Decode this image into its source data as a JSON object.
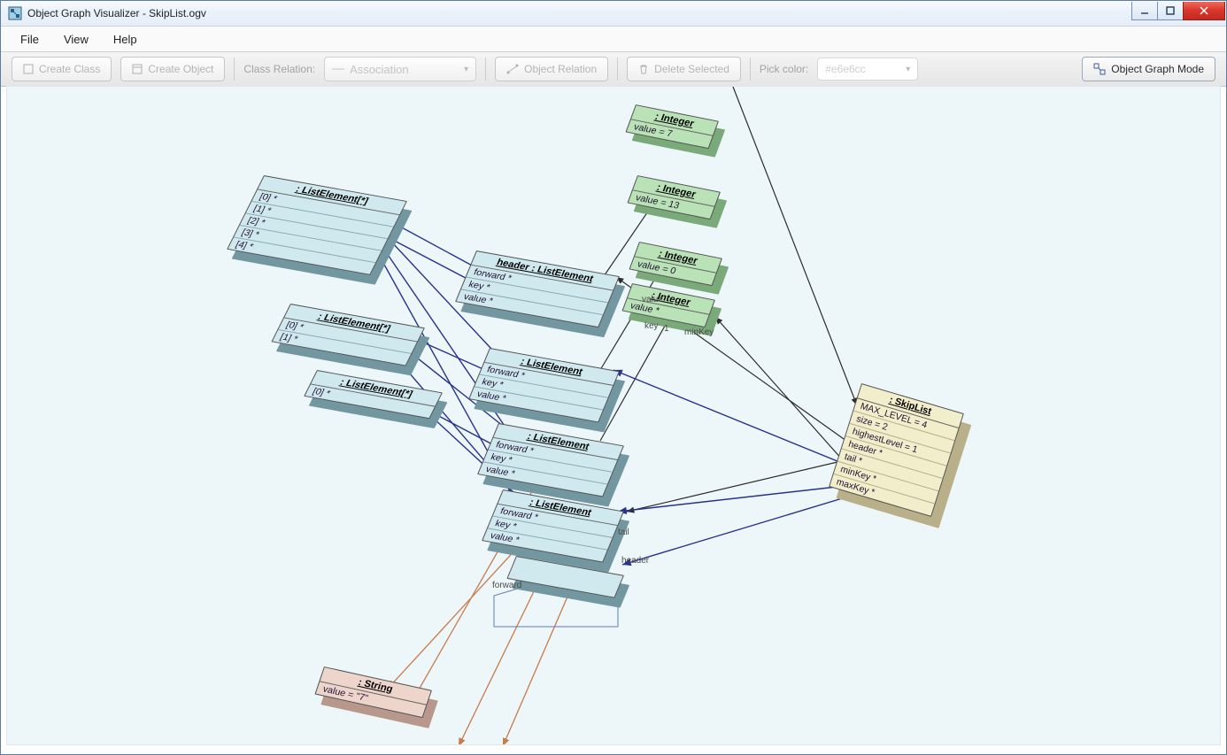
{
  "window": {
    "title": "Object Graph Visualizer - SkipList.ogv"
  },
  "menu": {
    "file": "File",
    "view": "View",
    "help": "Help"
  },
  "toolbar": {
    "create_class": "Create Class",
    "create_object": "Create Object",
    "class_relation_label": "Class Relation:",
    "class_relation_value": "Association",
    "object_relation": "Object Relation",
    "delete_selected": "Delete Selected",
    "pick_color_label": "Pick color:",
    "pick_color_value": "#e6e6cc",
    "mode_button": "Object Graph Mode"
  },
  "diagram": {
    "nodes": {
      "listElemArr0": {
        "title": ": ListElement[*]",
        "rows": [
          "[0] *",
          "[1] *",
          "[2] *",
          "[3] *",
          "[4] *"
        ]
      },
      "listElemArr1": {
        "title": ": ListElement[*]",
        "rows": [
          "[0] *",
          "[1] *"
        ]
      },
      "listElemArr2": {
        "title": ": ListElement[*]",
        "rows": [
          "[0] *"
        ]
      },
      "header": {
        "title": "header : ListElement",
        "rows": [
          "forward *",
          "key *",
          "value *"
        ]
      },
      "le1": {
        "title": ": ListElement",
        "rows": [
          "forward *",
          "key *",
          "value *"
        ]
      },
      "le2": {
        "title": ": ListElement",
        "rows": [
          "forward *",
          "key *",
          "value *"
        ]
      },
      "le3": {
        "title": ": ListElement",
        "rows": [
          "forward *",
          "key *",
          "value *"
        ]
      },
      "int0": {
        "title": ": Integer",
        "rows": [
          "value = 7"
        ]
      },
      "int1": {
        "title": ": Integer",
        "rows": [
          "value = 13"
        ]
      },
      "int2": {
        "title": ": Integer",
        "rows": [
          "value = 0"
        ]
      },
      "int3": {
        "title": ": Integer",
        "rows": [
          "value *"
        ]
      },
      "skip": {
        "title": ": SkipList",
        "rows": [
          "MAX_LEVEL = 4",
          "size = 2",
          "highestLevel = 1",
          "header *",
          "tail *",
          "minKey *",
          "maxKey *"
        ]
      },
      "str": {
        "title": ": String",
        "rows": [
          "value = \"7\""
        ]
      }
    },
    "edgeLabels": {
      "value": "value",
      "key": "key",
      "one": "1",
      "minKey": "minKey",
      "tail": "tail",
      "header2": "header",
      "forward": "forward"
    }
  }
}
